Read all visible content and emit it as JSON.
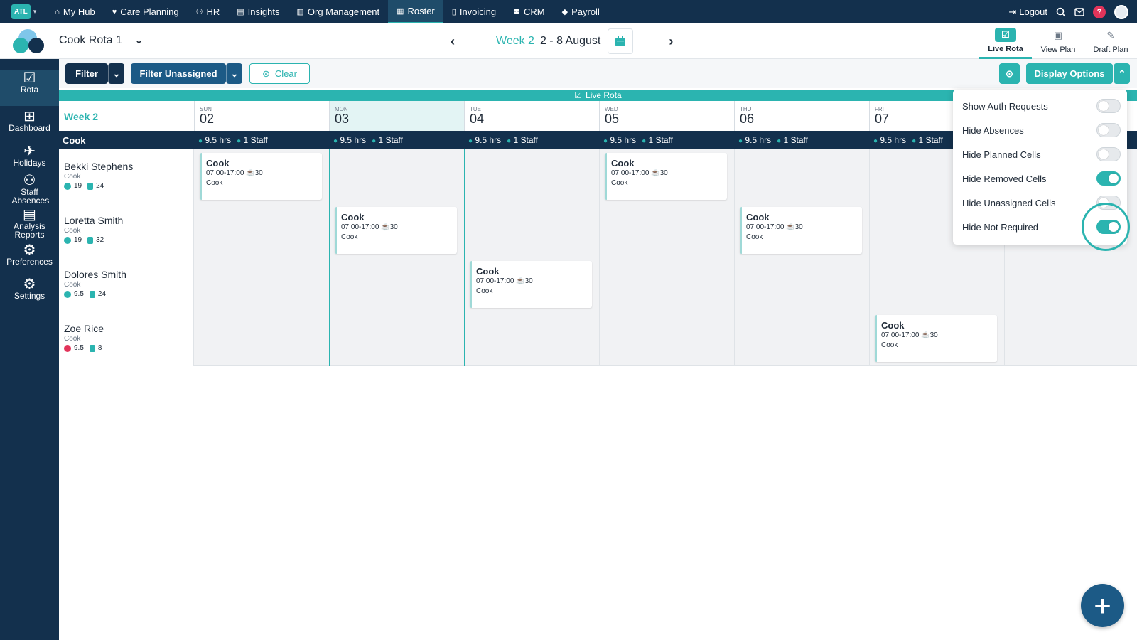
{
  "org_badge": "ATL",
  "nav": [
    {
      "label": "My Hub",
      "icon": "⌂"
    },
    {
      "label": "Care Planning",
      "icon": "♥"
    },
    {
      "label": "HR",
      "icon": "⚇"
    },
    {
      "label": "Insights",
      "icon": "▤"
    },
    {
      "label": "Org Management",
      "icon": "▥"
    },
    {
      "label": "Roster",
      "icon": "▦"
    },
    {
      "label": "Invoicing",
      "icon": "▯"
    },
    {
      "label": "CRM",
      "icon": "⚉"
    },
    {
      "label": "Payroll",
      "icon": "◆"
    }
  ],
  "top_right": {
    "logout": "Logout",
    "help": "?"
  },
  "header": {
    "rota_name": "Cook Rota 1",
    "week_label": "Week 2",
    "week_range": "2 - 8 August"
  },
  "view_tabs": [
    {
      "label": "Live Rota",
      "icon": "☑"
    },
    {
      "label": "View Plan",
      "icon": "▣"
    },
    {
      "label": "Draft Plan",
      "icon": "✎"
    }
  ],
  "sidebar": [
    {
      "label": "Rota",
      "icon": "☑"
    },
    {
      "label": "Dashboard",
      "icon": "⊞"
    },
    {
      "label": "Holidays",
      "icon": "✈"
    },
    {
      "label": "Staff Absences",
      "icon": "⚇"
    },
    {
      "label": "Analysis Reports",
      "icon": "▤"
    },
    {
      "label": "Preferences",
      "icon": "⚙"
    },
    {
      "label": "Settings",
      "icon": "⚙"
    }
  ],
  "toolbar": {
    "filter": "Filter",
    "filter_unassigned": "Filter Unassigned",
    "clear": "Clear",
    "display_options": "Display Options"
  },
  "grid": {
    "banner": "Live Rota",
    "week_title": "Week 2",
    "role": "Cook",
    "days": [
      {
        "abbr": "SUN",
        "num": "02"
      },
      {
        "abbr": "MON",
        "num": "03"
      },
      {
        "abbr": "TUE",
        "num": "04"
      },
      {
        "abbr": "WED",
        "num": "05"
      },
      {
        "abbr": "THU",
        "num": "06"
      },
      {
        "abbr": "FRI",
        "num": "07"
      }
    ],
    "summary": {
      "hours": "9.5 hrs",
      "staff": "1 Staff"
    },
    "staff": [
      {
        "name": "Bekki Stephens",
        "role": "Cook",
        "stat1": "19",
        "stat2": "24",
        "alert": false
      },
      {
        "name": "Loretta Smith",
        "role": "Cook",
        "stat1": "19",
        "stat2": "32",
        "alert": false
      },
      {
        "name": "Dolores Smith",
        "role": "Cook",
        "stat1": "9.5",
        "stat2": "24",
        "alert": false
      },
      {
        "name": "Zoe Rice",
        "role": "Cook",
        "stat1": "9.5",
        "stat2": "8",
        "alert": true
      }
    ],
    "shift": {
      "role": "Cook",
      "time": "07:00-17:00",
      "break": "30",
      "sub": "Cook"
    }
  },
  "display_options": [
    {
      "label": "Show Auth Requests",
      "on": false
    },
    {
      "label": "Hide Absences",
      "on": false
    },
    {
      "label": "Hide Planned Cells",
      "on": false
    },
    {
      "label": "Hide Removed Cells",
      "on": true
    },
    {
      "label": "Hide Unassigned Cells",
      "on": false
    },
    {
      "label": "Hide Not Required",
      "on": true
    }
  ],
  "fab": "+"
}
